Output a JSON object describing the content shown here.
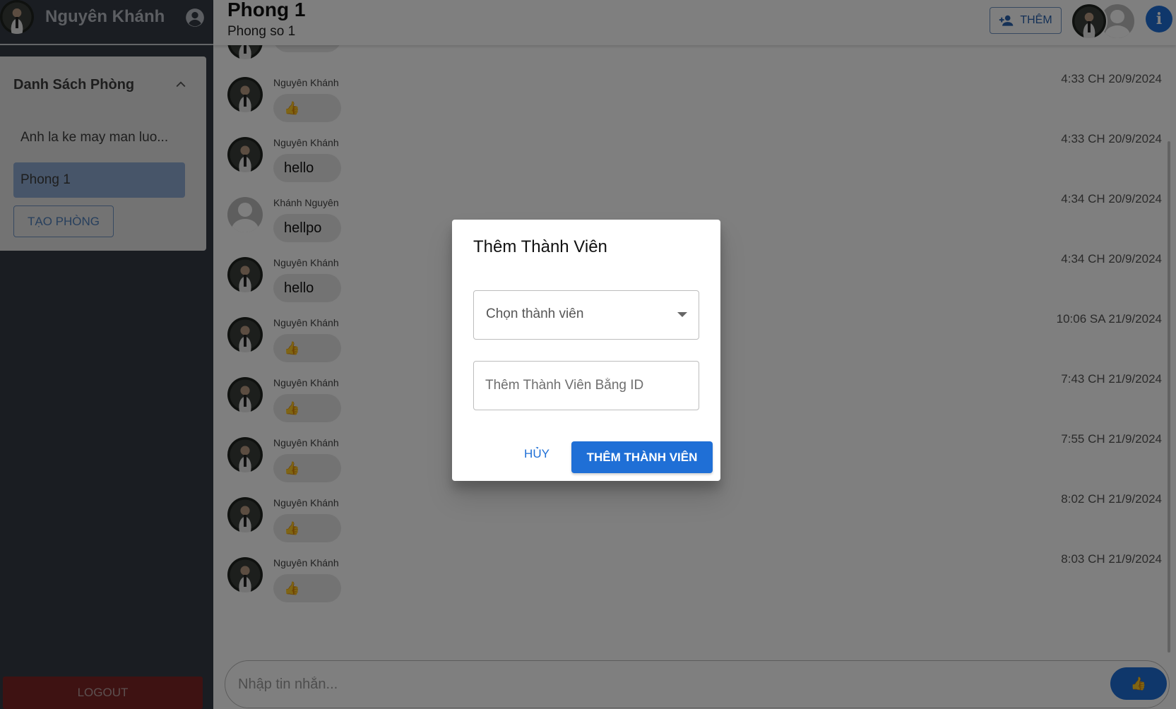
{
  "sidebar": {
    "user_name": "Nguyên Khánh",
    "room_list_title": "Danh Sách Phòng",
    "rooms": [
      {
        "label": "Anh la ke may man luo..."
      },
      {
        "label": "Phong 1"
      }
    ],
    "create_room_label": "TẠO PHÒNG",
    "logout_label": "LOGOUT"
  },
  "header": {
    "room_title": "Phong 1",
    "room_subtitle": "Phong so 1",
    "add_button_label": "THÊM",
    "info_label": "i"
  },
  "messages": [
    {
      "name": "",
      "text": "👍",
      "time": "",
      "avatar": "photo"
    },
    {
      "name": "Nguyên Khánh",
      "text": "👍",
      "time": "4:33 CH 20/9/2024",
      "avatar": "photo"
    },
    {
      "name": "Nguyên Khánh",
      "text": "hello",
      "time": "4:33 CH 20/9/2024",
      "avatar": "photo"
    },
    {
      "name": "Khánh Nguyên",
      "text": "hellpo",
      "time": "4:34 CH 20/9/2024",
      "avatar": "blank"
    },
    {
      "name": "Nguyên Khánh",
      "text": "hello",
      "time": "4:34 CH 20/9/2024",
      "avatar": "photo"
    },
    {
      "name": "Nguyên Khánh",
      "text": "👍",
      "time": "10:06 SA 21/9/2024",
      "avatar": "photo"
    },
    {
      "name": "Nguyên Khánh",
      "text": "👍",
      "time": "7:43 CH 21/9/2024",
      "avatar": "photo"
    },
    {
      "name": "Nguyên Khánh",
      "text": "👍",
      "time": "7:55 CH 21/9/2024",
      "avatar": "photo"
    },
    {
      "name": "Nguyên Khánh",
      "text": "👍",
      "time": "8:02 CH 21/9/2024",
      "avatar": "photo"
    },
    {
      "name": "Nguyên Khánh",
      "text": "👍",
      "time": "8:03 CH 21/9/2024",
      "avatar": "photo"
    }
  ],
  "composer": {
    "placeholder": "Nhập tin nhắn...",
    "send_label": "👍"
  },
  "dialog": {
    "title": "Thêm Thành Viên",
    "select_value": "Chọn thành viên",
    "id_placeholder": "Thêm Thành Viên Bằng ID",
    "cancel_label": "HỦY",
    "confirm_label": "THÊM THÀNH VIÊN"
  },
  "colors": {
    "accent": "#1f6fd6",
    "sidebar_bg": "#353b45",
    "logout_bg": "#c62828",
    "selected_room_bg": "#8eaad2"
  },
  "icons": [
    "account-circle-icon",
    "chevron-up-icon",
    "person-add-icon",
    "info-icon",
    "thumbs-up-icon",
    "dropdown-caret-icon"
  ]
}
